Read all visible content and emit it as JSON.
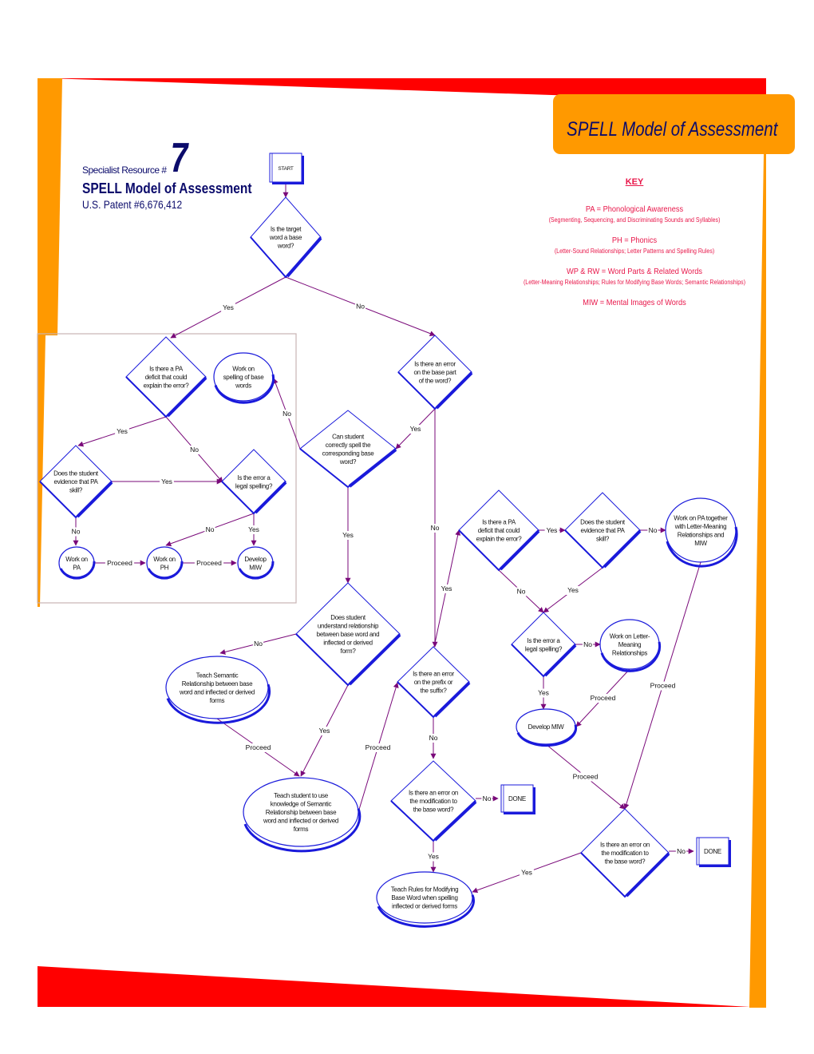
{
  "header": {
    "resource_label": "Specialist Resource #",
    "resource_number": "7",
    "title": "SPELL Model of Assessment",
    "patent": "U.S. Patent #6,676,412"
  },
  "banner": {
    "title": "SPELL Model of Assessment"
  },
  "key": {
    "title": "KEY",
    "entries": [
      {
        "definition": "PA = Phonological Awareness",
        "detail": "(Segmenting, Sequencing, and Discriminating Sounds and Syllables)"
      },
      {
        "definition": "PH = Phonics",
        "detail": "(Letter-Sound Relationships; Letter Patterns and Spelling Rules)"
      },
      {
        "definition": "WP & RW = Word Parts & Related Words",
        "detail": "(Letter-Meaning Relationships; Rules for Modifying Base Words; Semantic Relationships)"
      },
      {
        "definition": "MIW = Mental Images of Words",
        "detail": ""
      }
    ]
  },
  "colors": {
    "frame_red": "#ff0000",
    "frame_orange": "#ff9900",
    "shape_blue": "#1a1adb",
    "arrow_purple": "#7a0a7a",
    "title_navy": "#0b0b6b",
    "key_pink": "#e8174a"
  },
  "flowchart": {
    "nodes": [
      {
        "id": "start",
        "type": "process",
        "lines": [
          "START"
        ]
      },
      {
        "id": "q_base",
        "type": "decision",
        "lines": [
          "Is the target",
          "word a base",
          "word?"
        ]
      },
      {
        "id": "q_pa1",
        "type": "decision",
        "lines": [
          "Is there a PA",
          "deficit that could",
          "explain the error?"
        ]
      },
      {
        "id": "t_spell_base",
        "type": "terminal",
        "lines": [
          "Work on",
          "spelling of base",
          "words"
        ]
      },
      {
        "id": "q_evid1",
        "type": "decision",
        "lines": [
          "Does the student",
          "evidence that PA",
          "skill?"
        ]
      },
      {
        "id": "q_legal1",
        "type": "decision",
        "lines": [
          "Is the error a",
          "legal spelling?"
        ]
      },
      {
        "id": "t_pa",
        "type": "terminal",
        "lines": [
          "Work on",
          "PA"
        ]
      },
      {
        "id": "t_ph",
        "type": "terminal",
        "lines": [
          "Work on",
          "PH"
        ]
      },
      {
        "id": "t_miw1",
        "type": "terminal",
        "lines": [
          "Develop",
          "MIW"
        ]
      },
      {
        "id": "q_basepart",
        "type": "decision",
        "lines": [
          "Is there an error",
          "on the base part",
          "of the word?"
        ]
      },
      {
        "id": "q_canspell",
        "type": "decision",
        "lines": [
          "Can student",
          "correctly spell the",
          "corresponding base",
          "word?"
        ]
      },
      {
        "id": "q_understand",
        "type": "decision",
        "lines": [
          "Does student",
          "understand relationship",
          "between base word and",
          "inflected or derived",
          "form?"
        ]
      },
      {
        "id": "t_sem",
        "type": "terminal",
        "lines": [
          "Teach Semantic",
          "Relationship between base",
          "word and inflected or derived",
          "forms"
        ]
      },
      {
        "id": "t_usesem",
        "type": "terminal",
        "lines": [
          "Teach student to use",
          "knowledge of Semantic",
          "Relationship between base",
          "word and inflected or derived",
          "forms"
        ]
      },
      {
        "id": "q_prefix",
        "type": "decision",
        "lines": [
          "Is there an error",
          "on the prefix or",
          "the suffix?"
        ]
      },
      {
        "id": "q_mod1",
        "type": "decision",
        "lines": [
          "Is there an error on",
          "the modification to",
          "the base word?"
        ]
      },
      {
        "id": "done1",
        "type": "process",
        "lines": [
          "DONE"
        ]
      },
      {
        "id": "t_rules",
        "type": "terminal",
        "lines": [
          "Teach Rules for Modifying",
          "Base Word when spelling",
          "inflected or derived forms"
        ]
      },
      {
        "id": "q_pa2",
        "type": "decision",
        "lines": [
          "Is there a PA",
          "deficit that could",
          "explain the error?"
        ]
      },
      {
        "id": "q_evid2",
        "type": "decision",
        "lines": [
          "Does the student",
          "evidence that PA",
          "skill?"
        ]
      },
      {
        "id": "t_pa_lm",
        "type": "terminal",
        "lines": [
          "Work on PA together",
          "with Letter-Meaning",
          "Relationships and",
          "MIW"
        ]
      },
      {
        "id": "q_legal2",
        "type": "decision",
        "lines": [
          "Is the error a",
          "legal spelling?"
        ]
      },
      {
        "id": "t_lm",
        "type": "terminal",
        "lines": [
          "Work on Letter-",
          "Meaning",
          "Relationships"
        ]
      },
      {
        "id": "t_miw2",
        "type": "terminal",
        "lines": [
          "Develop MIW"
        ]
      },
      {
        "id": "q_mod2",
        "type": "decision",
        "lines": [
          "Is there an error on",
          "the modification to",
          "the base word?"
        ]
      },
      {
        "id": "done2",
        "type": "process",
        "lines": [
          "DONE"
        ]
      }
    ],
    "edges": [
      {
        "from": "start",
        "to": "q_base",
        "label": ""
      },
      {
        "from": "q_base",
        "to": "q_pa1",
        "label": "Yes"
      },
      {
        "from": "q_base",
        "to": "q_basepart",
        "label": "No"
      },
      {
        "from": "q_pa1",
        "to": "q_evid1",
        "label": "Yes"
      },
      {
        "from": "q_pa1",
        "to": "q_legal1",
        "label": "No"
      },
      {
        "from": "q_evid1",
        "to": "q_legal1",
        "label": "Yes"
      },
      {
        "from": "q_evid1",
        "to": "t_pa",
        "label": "No"
      },
      {
        "from": "q_legal1",
        "to": "t_ph",
        "label": "No"
      },
      {
        "from": "q_legal1",
        "to": "t_miw1",
        "label": "Yes"
      },
      {
        "from": "t_pa",
        "to": "t_ph",
        "label": "Proceed"
      },
      {
        "from": "t_ph",
        "to": "t_miw1",
        "label": "Proceed"
      },
      {
        "from": "q_basepart",
        "to": "q_canspell",
        "label": "Yes"
      },
      {
        "from": "q_basepart",
        "to": "q_prefix",
        "label": "No"
      },
      {
        "from": "q_canspell",
        "to": "t_spell_base",
        "label": "No"
      },
      {
        "from": "q_canspell",
        "to": "q_understand",
        "label": "Yes"
      },
      {
        "from": "q_understand",
        "to": "t_sem",
        "label": "No"
      },
      {
        "from": "q_understand",
        "to": "t_usesem",
        "label": "Yes"
      },
      {
        "from": "t_sem",
        "to": "t_usesem",
        "label": "Proceed"
      },
      {
        "from": "t_usesem",
        "to": "q_prefix",
        "label": "Proceed"
      },
      {
        "from": "q_prefix",
        "to": "q_mod1",
        "label": "No"
      },
      {
        "from": "q_prefix",
        "to": "q_pa2",
        "label": "Yes"
      },
      {
        "from": "q_mod1",
        "to": "done1",
        "label": "No"
      },
      {
        "from": "q_mod1",
        "to": "t_rules",
        "label": "Yes"
      },
      {
        "from": "q_pa2",
        "to": "q_evid2",
        "label": "Yes"
      },
      {
        "from": "q_pa2",
        "to": "q_legal2",
        "label": "No"
      },
      {
        "from": "q_evid2",
        "to": "t_pa_lm",
        "label": "No"
      },
      {
        "from": "q_evid2",
        "to": "q_legal2",
        "label": "Yes"
      },
      {
        "from": "q_legal2",
        "to": "t_lm",
        "label": "No"
      },
      {
        "from": "q_legal2",
        "to": "t_miw2",
        "label": "Yes"
      },
      {
        "from": "t_lm",
        "to": "t_miw2",
        "label": "Proceed"
      },
      {
        "from": "t_miw2",
        "to": "q_mod2",
        "label": "Proceed"
      },
      {
        "from": "t_pa_lm",
        "to": "q_mod2",
        "label": "Proceed"
      },
      {
        "from": "q_mod2",
        "to": "done2",
        "label": "No"
      },
      {
        "from": "q_mod2",
        "to": "t_rules",
        "label": "Yes"
      }
    ]
  }
}
